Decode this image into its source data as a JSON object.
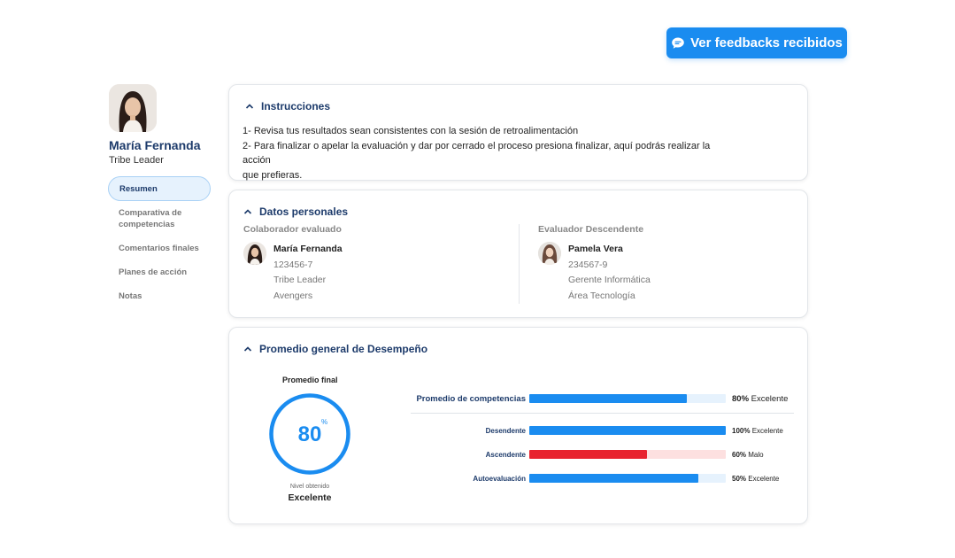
{
  "header": {
    "feedback_button": "Ver feedbacks recibidos"
  },
  "profile": {
    "name": "María Fernanda",
    "role": "Tribe Leader"
  },
  "nav": {
    "items": [
      {
        "label": "Resumen",
        "active": true
      },
      {
        "label": "Comparativa de competencias",
        "active": false
      },
      {
        "label": "Comentarios finales",
        "active": false
      },
      {
        "label": "Planes de acción",
        "active": false
      },
      {
        "label": "Notas",
        "active": false
      }
    ]
  },
  "instructions": {
    "title": "Instrucciones",
    "line1": "1- Revisa tus resultados sean consistentes con la sesión de retroalimentación",
    "line2": "2- Para finalizar o apelar la evaluación y dar por cerrado el proceso presiona finalizar, aquí podrás realizar la acción",
    "line3": "que prefieras."
  },
  "personal": {
    "title": "Datos personales",
    "evaluated": {
      "heading": "Colaborador evaluado",
      "name": "María Fernanda",
      "id": "123456-7",
      "role": "Tribe Leader",
      "team": "Avengers"
    },
    "evaluator": {
      "heading": "Evaluador Descendente",
      "name": "Pamela Vera",
      "id": "234567-9",
      "role": "Gerente Informática",
      "area": "Área Tecnología"
    }
  },
  "performance": {
    "title": "Promedio general de Desempeño",
    "final_label": "Promedio final",
    "final_value": "80",
    "final_unit": "%",
    "level_label": "Nivel obtenido",
    "level_value": "Excelente",
    "summary": {
      "label": "Promedio de competencias",
      "percent": 80,
      "value_text": "80%",
      "rating": "Excelente"
    },
    "rows": [
      {
        "label": "Desendente",
        "percent": 100,
        "value_text": "100%",
        "rating": "Excelente",
        "color": "#1a8cf0",
        "track": "#e6f2fd"
      },
      {
        "label": "Ascendente",
        "percent": 60,
        "value_text": "60%",
        "rating": "Malo",
        "color": "#e8232f",
        "track": "#fde0e0"
      },
      {
        "label": "Autoevaluación",
        "percent": 86,
        "value_text": "50%",
        "rating": "Excelente",
        "color": "#1a8cf0",
        "track": "#e6f2fd"
      }
    ]
  },
  "colors": {
    "primary": "#1a8cf0",
    "danger": "#e8232f",
    "title": "#1d3b6b"
  }
}
